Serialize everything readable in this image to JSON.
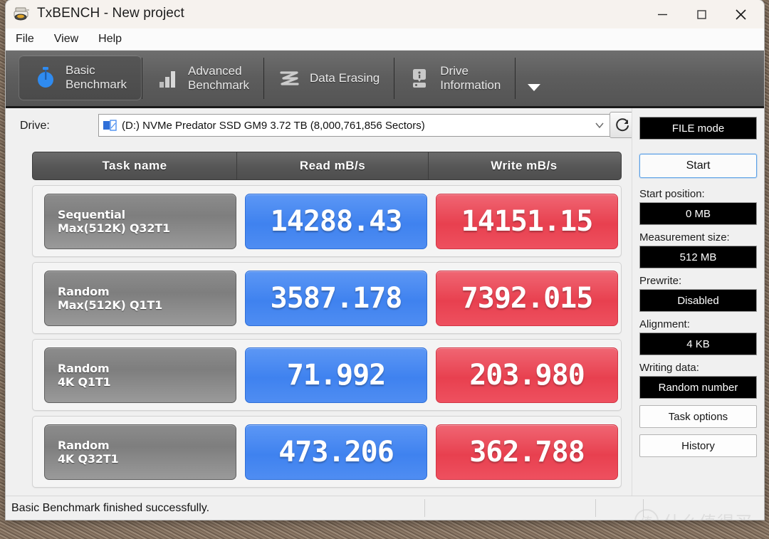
{
  "window": {
    "title": "TxBENCH - New project",
    "app_icon": "printer-icon",
    "controls": {
      "minimize": "minimize-icon",
      "maximize": "maximize-icon",
      "close": "close-icon"
    }
  },
  "menu": {
    "items": [
      "File",
      "View",
      "Help"
    ]
  },
  "tabs": [
    {
      "line1": "Basic",
      "line2": "Benchmark",
      "icon": "stopwatch-icon",
      "active": true
    },
    {
      "line1": "Advanced",
      "line2": "Benchmark",
      "icon": "bar-chart-icon",
      "active": false
    },
    {
      "line1": "Data Erasing",
      "line2": "",
      "icon": "eraser-wave-icon",
      "active": false
    },
    {
      "line1": "Drive",
      "line2": "Information",
      "icon": "drive-info-icon",
      "active": false
    }
  ],
  "tab_overflow_icon": "chevron-down-icon",
  "drive": {
    "label": "Drive:",
    "value": "(D:) NVMe Predator SSD GM9  3.72 TB (8,000,761,856 Sectors)",
    "icon": "disk-icon",
    "caret": "chevron-down-icon",
    "refresh_icon": "refresh-icon"
  },
  "table": {
    "headers": [
      "Task name",
      "Read mB/s",
      "Write mB/s"
    ],
    "rows": [
      {
        "task_line1": "Sequential",
        "task_line2": "Max(512K) Q32T1",
        "read": "14288.43",
        "write": "14151.15"
      },
      {
        "task_line1": "Random",
        "task_line2": "Max(512K) Q1T1",
        "read": "3587.178",
        "write": "7392.015"
      },
      {
        "task_line1": "Random",
        "task_line2": "4K Q1T1",
        "read": "71.992",
        "write": "203.980"
      },
      {
        "task_line1": "Random",
        "task_line2": "4K Q32T1",
        "read": "473.206",
        "write": "362.788"
      }
    ]
  },
  "sidebar": {
    "mode_value": "FILE mode",
    "start_label": "Start",
    "start_position_label": "Start position:",
    "start_position_value": "0 MB",
    "measurement_size_label": "Measurement size:",
    "measurement_size_value": "512 MB",
    "prewrite_label": "Prewrite:",
    "prewrite_value": "Disabled",
    "alignment_label": "Alignment:",
    "alignment_value": "4 KB",
    "writing_data_label": "Writing data:",
    "writing_data_value": "Random number",
    "task_options_label": "Task options",
    "history_label": "History"
  },
  "status": {
    "text": "Basic Benchmark finished successfully."
  },
  "watermark": {
    "badge": "值",
    "text": "什么值得买"
  },
  "colors": {
    "read_chip": "#4a8ef0",
    "write_chip": "#ed4f5e",
    "tab_active": "#4f4f4f",
    "tabstrip": "#5d5d5d",
    "lcd_bg": "#000000",
    "accent_focus": "#5aa0e6"
  }
}
